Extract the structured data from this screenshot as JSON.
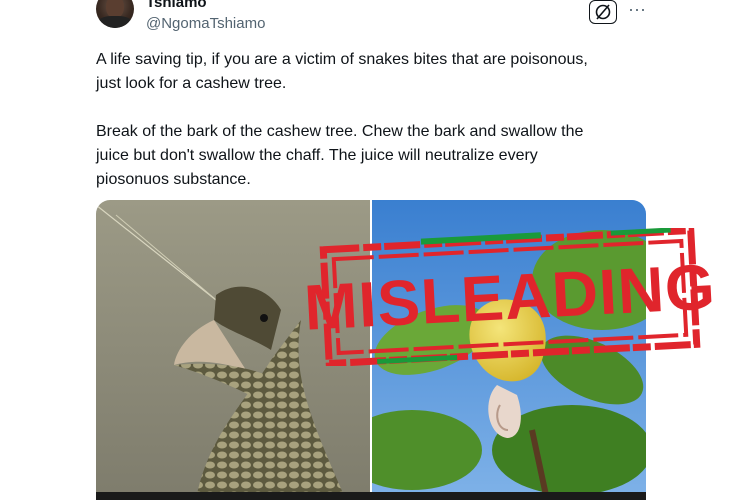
{
  "author": {
    "display_name": "Tshiamo",
    "handle": "@NgomaTshiamo"
  },
  "actions": {
    "grok_icon": "grok-icon",
    "more_label": "···"
  },
  "tweet": {
    "paragraph1": "A life saving tip, if you are a victim of snakes bites that are poisonous,\njust look for a cashew tree.",
    "paragraph2": "Break of the bark of the cashew tree. Chew the bark and swallow the\njuice but don't  swallow the chaff. The juice will neutralize every\npiosonuos substance."
  },
  "stamp": {
    "label": "MISLEADING",
    "color": "#e0252c",
    "accent_green": "#1a9a3a"
  }
}
